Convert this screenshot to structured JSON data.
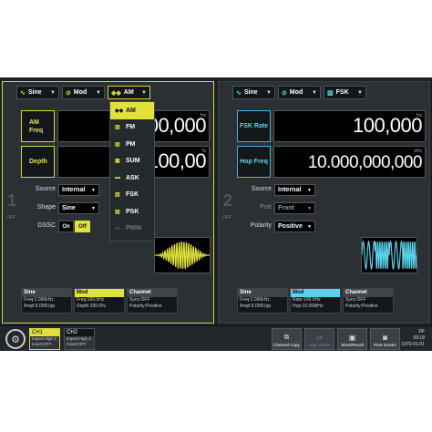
{
  "ch1": {
    "number": "1",
    "state": "OFF",
    "wave": "Sine",
    "mode": "Mod",
    "mod_type": "AM",
    "params": [
      {
        "label": "AM Freq",
        "value": "000,000",
        "unit": "Hz"
      },
      {
        "label": "Depth",
        "value": "100,00",
        "unit": "%"
      }
    ],
    "source_label": "Source",
    "source_value": "Internal",
    "shape_label": "Shape",
    "shape_value": "Sine",
    "dssc_label": "DSSC",
    "dssc_on": "On",
    "dssc_off": "Off",
    "cards": [
      {
        "title": "Sine",
        "lines": [
          "Freq:1.000kHz",
          "Ampl:5.000Vpp"
        ]
      },
      {
        "title": "Mod",
        "lines": [
          "Freq:100.0Hz",
          "Depth:100.0%"
        ]
      },
      {
        "title": "Channel",
        "lines": [
          "Sync:OFF",
          "Polarity:Positive"
        ]
      }
    ]
  },
  "ch2": {
    "number": "2",
    "state": "OFF",
    "wave": "Sine",
    "mode": "Mod",
    "mod_type": "FSK",
    "params": [
      {
        "label": "FSK Rate",
        "value": "100,000",
        "unit": "Hz"
      },
      {
        "label": "Hop Freq",
        "value": "10.000,000,000",
        "unit": "kHz"
      }
    ],
    "source_label": "Source",
    "source_value": "Internal",
    "port_label": "Port",
    "port_value": "Front",
    "polarity_label": "Polarity",
    "polarity_value": "Positive",
    "cards": [
      {
        "title": "Sine",
        "lines": [
          "Freq:1.000kHz",
          "Ampl:5.000Vpp"
        ]
      },
      {
        "title": "Mod",
        "lines": [
          "Rate:100.0Hz",
          "Hop:10.00MHz"
        ]
      },
      {
        "title": "Channel",
        "lines": [
          "Sync:OFF",
          "Polarity:Positive"
        ]
      }
    ]
  },
  "menu": {
    "items": [
      "AM",
      "FM",
      "PM",
      "SUM",
      "ASK",
      "FSK",
      "PSK",
      "PWM"
    ],
    "selected": "AM",
    "disabled": [
      "PWM"
    ]
  },
  "bottom": {
    "ch1_tab": {
      "title": "CH1",
      "lines": [
        "Imped:High Z",
        "Invert:OFF"
      ]
    },
    "ch2_tab": {
      "title": "CH2",
      "lines": [
        "Imped:High Z",
        "Invert:OFF"
      ]
    },
    "buttons": [
      "Channel Copy",
      "Align Phase",
      "Store/Recall",
      "Print Screen"
    ],
    "status_top": "DF",
    "time": "09:18",
    "date": "1970-01-01"
  },
  "colors": {
    "accent_ch1": "#e1e13b",
    "accent_ch2": "#58d3ec"
  }
}
